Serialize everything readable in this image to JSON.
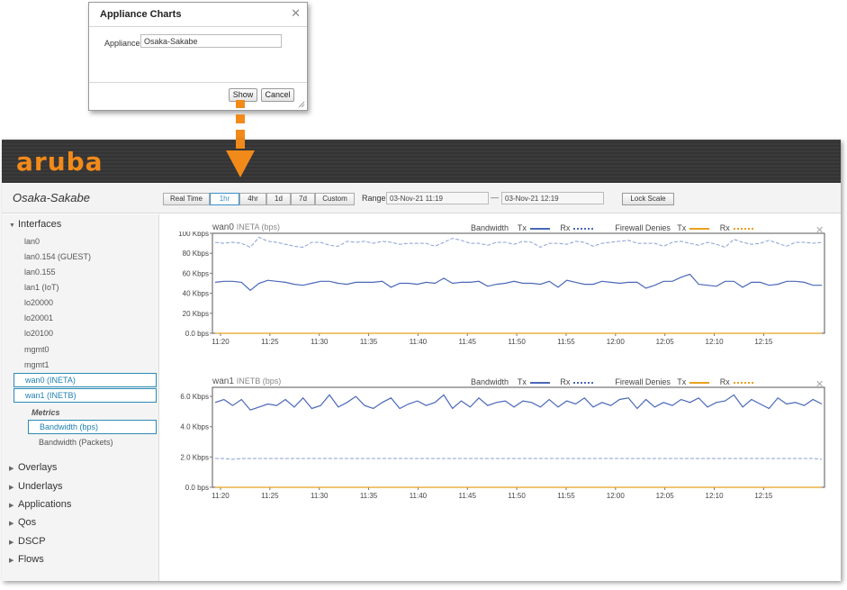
{
  "dialog": {
    "title": "Appliance Charts",
    "field_label": "Appliance",
    "field_value": "Osaka-Sakabe",
    "show_label": "Show",
    "cancel_label": "Cancel"
  },
  "header": {
    "logo": "aruba"
  },
  "toolbar": {
    "appliance_name": "Osaka-Sakabe",
    "time_buttons": [
      "Real Time",
      "1hr",
      "4hr",
      "1d",
      "7d",
      "Custom"
    ],
    "active_time": "1hr",
    "range_label": "Range",
    "range_from": "03-Nov-21 11:19",
    "range_to": "03-Nov-21 12:19",
    "lock_label": "Lock Scale"
  },
  "sidebar": {
    "interfaces_label": "Interfaces",
    "interfaces": [
      "lan0",
      "lan0.154 (GUEST)",
      "lan0.155",
      "lan1 (IoT)",
      "lo20000",
      "lo20001",
      "lo20100",
      "mgmt0",
      "mgmt1",
      "wan0 (INETA)",
      "wan1 (INETB)"
    ],
    "metrics_label": "Metrics",
    "metrics": [
      "Bandwidth (bps)",
      "Bandwidth (Packets)"
    ],
    "sections": [
      "Overlays",
      "Underlays",
      "Applications",
      "Qos",
      "DSCP",
      "Flows"
    ]
  },
  "legend": {
    "bandwidth": "Bandwidth",
    "firewall": "Firewall Denies",
    "tx": "Tx",
    "rx": "Rx"
  },
  "colors": {
    "accent": "#f28a1a",
    "bandwidth": "#4a68b8",
    "firewall": "#e8a020",
    "selection": "#2b8bb8"
  },
  "chart_data": [
    {
      "type": "line",
      "title": "wan0",
      "subtitle": "INETA (bps)",
      "x_ticks": [
        "11:20",
        "11:25",
        "11:30",
        "11:35",
        "11:40",
        "11:45",
        "11:50",
        "11:55",
        "12:00",
        "12:05",
        "12:10",
        "12:15"
      ],
      "y_ticks": [
        "100 Kbps",
        "80 Kbps",
        "60 Kbps",
        "40 Kbps",
        "20 Kbps",
        "0.0 bps"
      ],
      "ylim": [
        0,
        100
      ],
      "series": [
        {
          "name": "Bandwidth Tx",
          "values": [
            51,
            52,
            52,
            51,
            43,
            50,
            53,
            52,
            51,
            49,
            48,
            50,
            52,
            52,
            50,
            49,
            51,
            51,
            51,
            52,
            46,
            50,
            50,
            49,
            51,
            50,
            55,
            50,
            51,
            51,
            52,
            47,
            49,
            50,
            52,
            50,
            50,
            49,
            52,
            46,
            53,
            51,
            49,
            49,
            52,
            51,
            50,
            51,
            51,
            45,
            48,
            52,
            52,
            56,
            59,
            49,
            48,
            47,
            52,
            52,
            46,
            51,
            51,
            48,
            49,
            52,
            52,
            51,
            48,
            48
          ]
        },
        {
          "name": "Bandwidth Rx",
          "values": [
            91,
            90,
            91,
            90,
            86,
            96,
            92,
            91,
            89,
            87,
            86,
            91,
            91,
            88,
            87,
            92,
            91,
            92,
            90,
            92,
            91,
            89,
            90,
            90,
            90,
            87,
            91,
            95,
            93,
            90,
            90,
            88,
            91,
            91,
            89,
            92,
            91,
            86,
            90,
            90,
            89,
            92,
            91,
            87,
            90,
            91,
            92,
            93,
            90,
            90,
            90,
            87,
            91,
            92,
            90,
            88,
            91,
            89,
            86,
            94,
            91,
            89,
            90,
            93,
            90,
            87,
            91,
            91,
            90,
            91
          ]
        },
        {
          "name": "Firewall Denies Tx",
          "values": [
            0,
            0,
            0,
            0,
            0,
            0,
            0,
            0,
            0,
            0,
            0,
            0,
            0,
            0,
            0,
            0,
            0,
            0,
            0,
            0,
            0,
            0,
            0,
            0,
            0,
            0,
            0,
            0,
            0,
            0,
            0,
            0,
            0,
            0,
            0,
            0,
            0,
            0,
            0,
            0,
            0,
            0,
            0,
            0,
            0,
            0,
            0,
            0,
            0,
            0,
            0,
            0,
            0,
            0,
            0,
            0,
            0,
            0,
            0,
            0,
            0,
            0,
            0,
            0,
            0,
            0,
            0,
            0,
            0,
            0
          ]
        },
        {
          "name": "Firewall Denies Rx",
          "values": [
            0,
            0,
            0,
            0,
            0,
            0,
            0,
            0,
            0,
            0,
            0,
            0,
            0,
            0,
            0,
            0,
            0,
            0,
            0,
            0,
            0,
            0,
            0,
            0,
            0,
            0,
            0,
            0,
            0,
            0,
            0,
            0,
            0,
            0,
            0,
            0,
            0,
            0,
            0,
            0,
            0,
            0,
            0,
            0,
            0,
            0,
            0,
            0,
            0,
            0,
            0,
            0,
            0,
            0,
            0,
            0,
            0,
            0,
            0,
            0,
            0,
            0,
            0,
            0,
            0,
            0,
            0,
            0,
            0,
            0
          ]
        }
      ]
    },
    {
      "type": "line",
      "title": "wan1",
      "subtitle": "INETB (bps)",
      "x_ticks": [
        "11:20",
        "11:25",
        "11:30",
        "11:35",
        "11:40",
        "11:45",
        "11:50",
        "11:55",
        "12:00",
        "12:05",
        "12:10",
        "12:15"
      ],
      "y_ticks": [
        "6.0 Kbps",
        "4.0 Kbps",
        "2.0 Kbps",
        "0.0 bps"
      ],
      "ylim": [
        0,
        6.6
      ],
      "series": [
        {
          "name": "Bandwidth Tx",
          "values": [
            5.6,
            5.8,
            5.4,
            5.8,
            5.1,
            5.3,
            5.5,
            5.4,
            5.8,
            5.3,
            5.9,
            5.2,
            5.4,
            6.1,
            5.3,
            5.6,
            6.0,
            5.4,
            5.2,
            5.6,
            5.9,
            5.2,
            5.5,
            5.7,
            5.4,
            5.6,
            6.1,
            5.2,
            5.7,
            5.3,
            5.9,
            5.4,
            5.6,
            5.7,
            5.3,
            5.7,
            5.6,
            5.3,
            5.8,
            5.3,
            5.7,
            5.5,
            5.9,
            5.3,
            5.6,
            5.4,
            5.8,
            5.9,
            5.2,
            5.8,
            5.3,
            5.6,
            5.4,
            5.8,
            5.6,
            5.9,
            5.3,
            5.6,
            5.7,
            6.1,
            5.3,
            5.8,
            5.5,
            5.2,
            5.9,
            5.5,
            5.6,
            5.4,
            5.8,
            5.5
          ]
        },
        {
          "name": "Bandwidth Rx",
          "values": [
            1.9,
            1.9,
            1.85,
            1.9,
            1.9,
            1.9,
            1.9,
            1.9,
            1.9,
            1.9,
            1.9,
            1.9,
            1.9,
            1.9,
            1.9,
            1.9,
            1.9,
            1.9,
            1.9,
            1.9,
            1.9,
            1.9,
            1.9,
            1.9,
            1.9,
            1.9,
            1.9,
            1.9,
            1.9,
            1.9,
            1.9,
            1.9,
            1.9,
            1.9,
            1.9,
            1.9,
            1.9,
            1.9,
            1.9,
            1.9,
            1.9,
            1.9,
            1.9,
            1.9,
            1.9,
            1.9,
            1.9,
            1.9,
            1.9,
            1.9,
            1.9,
            1.9,
            1.9,
            1.9,
            1.9,
            1.9,
            1.9,
            1.9,
            1.9,
            1.9,
            1.9,
            1.9,
            1.9,
            1.9,
            1.9,
            1.9,
            1.9,
            1.9,
            1.9,
            1.85
          ]
        },
        {
          "name": "Firewall Denies Tx",
          "values": [
            0,
            0,
            0,
            0,
            0,
            0,
            0,
            0,
            0,
            0,
            0,
            0,
            0,
            0,
            0,
            0,
            0,
            0,
            0,
            0,
            0,
            0,
            0,
            0,
            0,
            0,
            0,
            0,
            0,
            0,
            0,
            0,
            0,
            0,
            0,
            0,
            0,
            0,
            0,
            0,
            0,
            0,
            0,
            0,
            0,
            0,
            0,
            0,
            0,
            0,
            0,
            0,
            0,
            0,
            0,
            0,
            0,
            0,
            0,
            0,
            0,
            0,
            0,
            0,
            0,
            0,
            0,
            0,
            0,
            0
          ]
        },
        {
          "name": "Firewall Denies Rx",
          "values": [
            0,
            0,
            0,
            0,
            0,
            0,
            0,
            0,
            0,
            0,
            0,
            0,
            0,
            0,
            0,
            0,
            0,
            0,
            0,
            0,
            0,
            0,
            0,
            0,
            0,
            0,
            0,
            0,
            0,
            0,
            0,
            0,
            0,
            0,
            0,
            0,
            0,
            0,
            0,
            0,
            0,
            0,
            0,
            0,
            0,
            0,
            0,
            0,
            0,
            0,
            0,
            0,
            0,
            0,
            0,
            0,
            0,
            0,
            0,
            0,
            0,
            0,
            0,
            0,
            0,
            0,
            0,
            0,
            0,
            0
          ]
        }
      ]
    }
  ]
}
